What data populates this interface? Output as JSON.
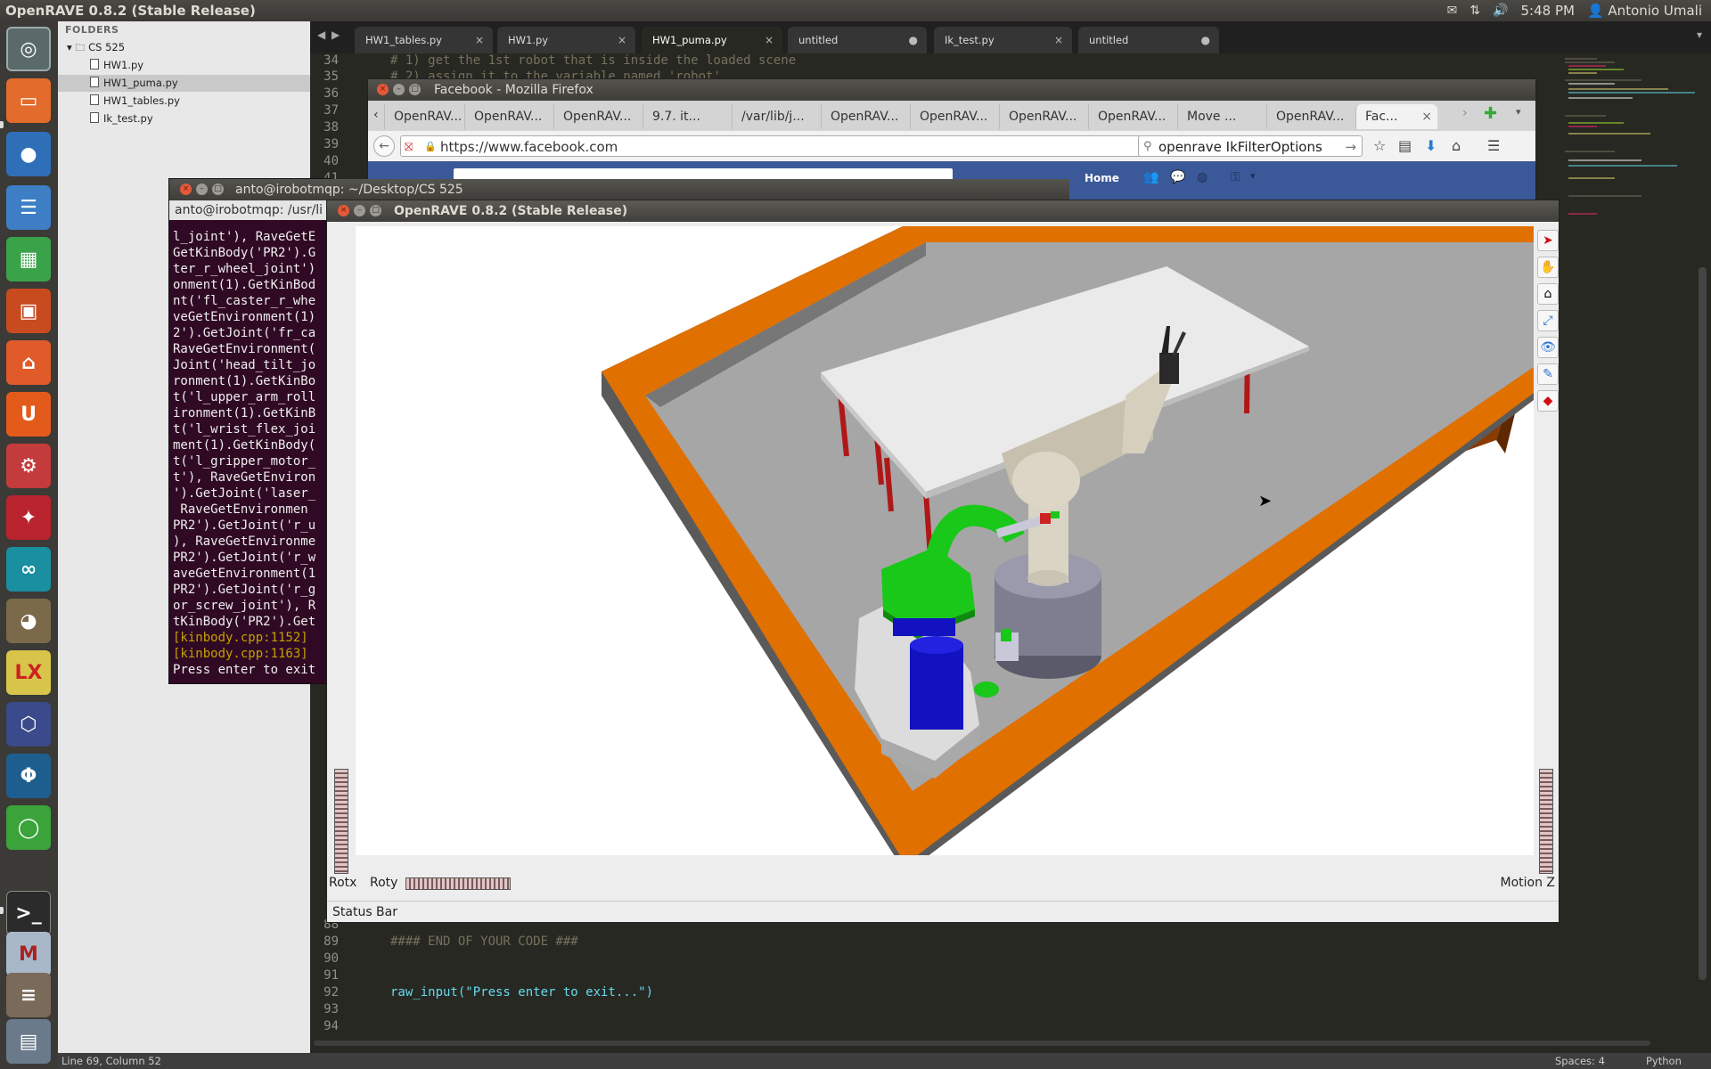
{
  "top_panel": {
    "title": "OpenRAVE 0.8.2 (Stable Release)",
    "time": "5:48 PM",
    "user": "Antonio Umali",
    "icons": [
      "mail-icon",
      "network-icon",
      "volume-icon",
      "user-icon"
    ]
  },
  "sublime": {
    "folders_header": "FOLDERS",
    "tree": [
      {
        "label": "CS 525",
        "type": "folder"
      },
      {
        "label": "HW1.py",
        "type": "file"
      },
      {
        "label": "HW1_puma.py",
        "type": "file",
        "selected": true
      },
      {
        "label": "HW1_tables.py",
        "type": "file"
      },
      {
        "label": "Ik_test.py",
        "type": "file"
      }
    ],
    "tabs": [
      {
        "label": "HW1_tables.py",
        "close": "×"
      },
      {
        "label": "HW1.py",
        "close": "×"
      },
      {
        "label": "HW1_puma.py",
        "close": "×",
        "active": true
      },
      {
        "label": "untitled",
        "close": "●"
      },
      {
        "label": "Ik_test.py",
        "close": "×"
      },
      {
        "label": "untitled",
        "close": "●"
      }
    ],
    "code_top": [
      {
        "num": "34",
        "text": "# 1) get the 1st robot that is inside the loaded scene"
      },
      {
        "num": "35",
        "text": "# 2) assign it to the variable named 'robot'"
      },
      {
        "num": "36",
        "text": ""
      },
      {
        "num": "37",
        "text": ""
      },
      {
        "num": "38",
        "text": ""
      },
      {
        "num": "39",
        "text": ""
      },
      {
        "num": "40",
        "text": ""
      },
      {
        "num": "41",
        "text": ""
      }
    ],
    "code_bottom": [
      {
        "num": "88",
        "text": "'''"
      },
      {
        "num": "89",
        "text": "#### END OF YOUR CODE ###"
      },
      {
        "num": "90",
        "text": ""
      },
      {
        "num": "91",
        "text": ""
      },
      {
        "num": "92",
        "text": "raw_input(\"Press enter to exit...\")"
      },
      {
        "num": "93",
        "text": ""
      },
      {
        "num": "94",
        "text": ""
      }
    ],
    "status_left": "Line 69, Column 52",
    "status_spaces": "Spaces: 4",
    "status_lang": "Python"
  },
  "firefox": {
    "title": "Facebook - Mozilla Firefox",
    "tabs": [
      "OpenRAV...",
      "OpenRAV...",
      "OpenRAV...",
      "9.7. it...",
      "/var/lib/j...",
      "OpenRAV...",
      "OpenRAV...",
      "OpenRAV...",
      "OpenRAV...",
      "Move ...",
      "OpenRAV...",
      "Fac..."
    ],
    "url": "https://www.facebook.com",
    "search": "openrave IkFilterOptions",
    "fb_home": "Home"
  },
  "terminal": {
    "title": "anto@irobotmqp: ~/Desktop/CS 525",
    "tab": "anto@irobotmqp: /usr/li",
    "lines": [
      {
        "t": "l_joint'), RaveGetE",
        "warn": false
      },
      {
        "t": "GetKinBody('PR2').G",
        "warn": false
      },
      {
        "t": "ter_r_wheel_joint')",
        "warn": false
      },
      {
        "t": "onment(1).GetKinBod",
        "warn": false
      },
      {
        "t": "nt('fl_caster_r_whe",
        "warn": false
      },
      {
        "t": "veGetEnvironment(1)",
        "warn": false
      },
      {
        "t": "2').GetJoint('fr_ca",
        "warn": false
      },
      {
        "t": "RaveGetEnvironment(",
        "warn": false
      },
      {
        "t": "Joint('head_tilt_jo",
        "warn": false
      },
      {
        "t": "ronment(1).GetKinBo",
        "warn": false
      },
      {
        "t": "t('l_upper_arm_roll",
        "warn": false
      },
      {
        "t": "ironment(1).GetKinB",
        "warn": false
      },
      {
        "t": "t('l_wrist_flex_joi",
        "warn": false
      },
      {
        "t": "ment(1).GetKinBody(",
        "warn": false
      },
      {
        "t": "t('l_gripper_motor_",
        "warn": false
      },
      {
        "t": "t'), RaveGetEnviron",
        "warn": false
      },
      {
        "t": "').GetJoint('laser_",
        "warn": false
      },
      {
        "t": " RaveGetEnvironmen",
        "warn": false
      },
      {
        "t": "PR2').GetJoint('r_u",
        "warn": false
      },
      {
        "t": "), RaveGetEnvironme",
        "warn": false
      },
      {
        "t": "PR2').GetJoint('r_w",
        "warn": false
      },
      {
        "t": "aveGetEnvironment(1",
        "warn": false
      },
      {
        "t": "PR2').GetJoint('r_g",
        "warn": false
      },
      {
        "t": "or_screw_joint'), R",
        "warn": false
      },
      {
        "t": "tKinBody('PR2').Get",
        "warn": false
      },
      {
        "t": "[kinbody.cpp:1152]",
        "warn": true
      },
      {
        "t": "[kinbody.cpp:1163]",
        "warn": true
      },
      {
        "t": "Press enter to exit",
        "warn": false
      }
    ]
  },
  "openrave": {
    "title": "OpenRAVE 0.8.2 (Stable Release)",
    "rotx": "Rotx",
    "roty": "Roty",
    "motionz": "Motion Z",
    "status": "Status Bar",
    "tools": [
      "select-tool-icon",
      "pan-tool-icon",
      "home-view-icon",
      "view-all-icon",
      "camera-eye-icon",
      "measure-tool-icon",
      "collision-icon"
    ]
  },
  "colors": {
    "frame": "#e07000",
    "floor": "#a6a6a6",
    "table_top": "#eaeaea",
    "table_leg": "#b01818",
    "wall": "#8a3c00",
    "pr2_green": "#19c819",
    "pr2_blue": "#1212c0"
  }
}
